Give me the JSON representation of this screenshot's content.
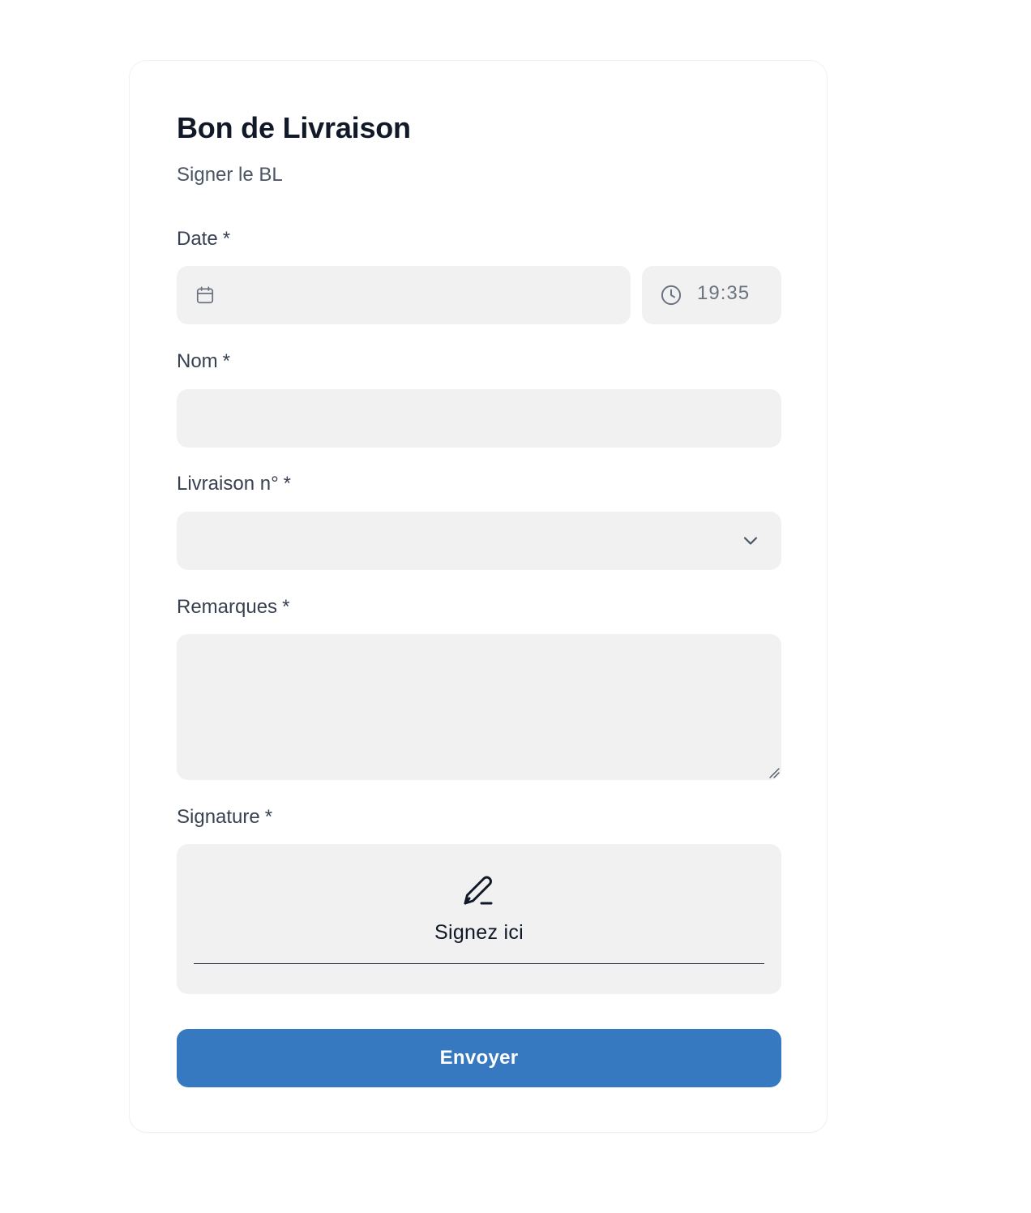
{
  "form": {
    "title": "Bon de Livraison",
    "subtitle": "Signer le BL",
    "required_marker": "*"
  },
  "fields": {
    "date": {
      "label": "Date",
      "date_value": "",
      "time_value": "19:35",
      "date_icon": "calendar-icon",
      "time_icon": "clock-icon"
    },
    "name": {
      "label": "Nom",
      "value": ""
    },
    "delivery_number": {
      "label": "Livraison n°",
      "selected_value": "",
      "icon": "chevron-down-icon"
    },
    "remarks": {
      "label": "Remarques",
      "value": ""
    },
    "signature": {
      "label": "Signature",
      "prompt": "Signez ici",
      "icon": "pen-icon"
    }
  },
  "actions": {
    "submit_label": "Envoyer"
  },
  "colors": {
    "accent": "#3779c0",
    "field_bg": "#f1f1f1",
    "heading": "#111827",
    "label": "#374151",
    "muted": "#6b7280"
  }
}
